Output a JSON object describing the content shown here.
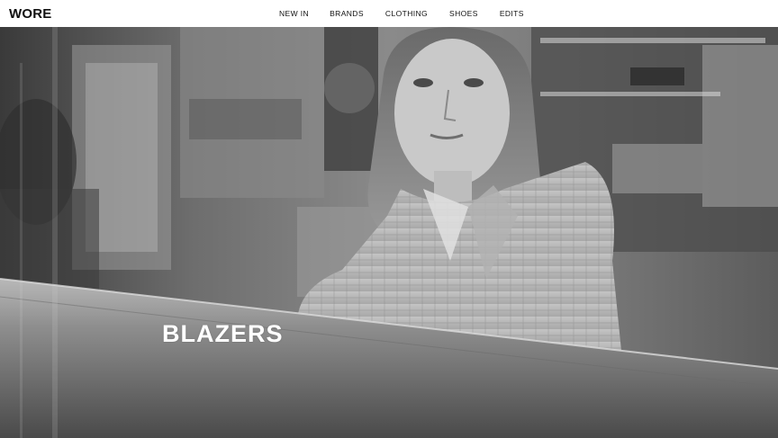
{
  "header": {
    "logo": "WORE",
    "nav": [
      {
        "label": "NEW IN"
      },
      {
        "label": "BRANDS"
      },
      {
        "label": "CLOTHING"
      },
      {
        "label": "SHOES"
      },
      {
        "label": "EDITS"
      }
    ]
  },
  "hero": {
    "title": "BLAZERS"
  }
}
